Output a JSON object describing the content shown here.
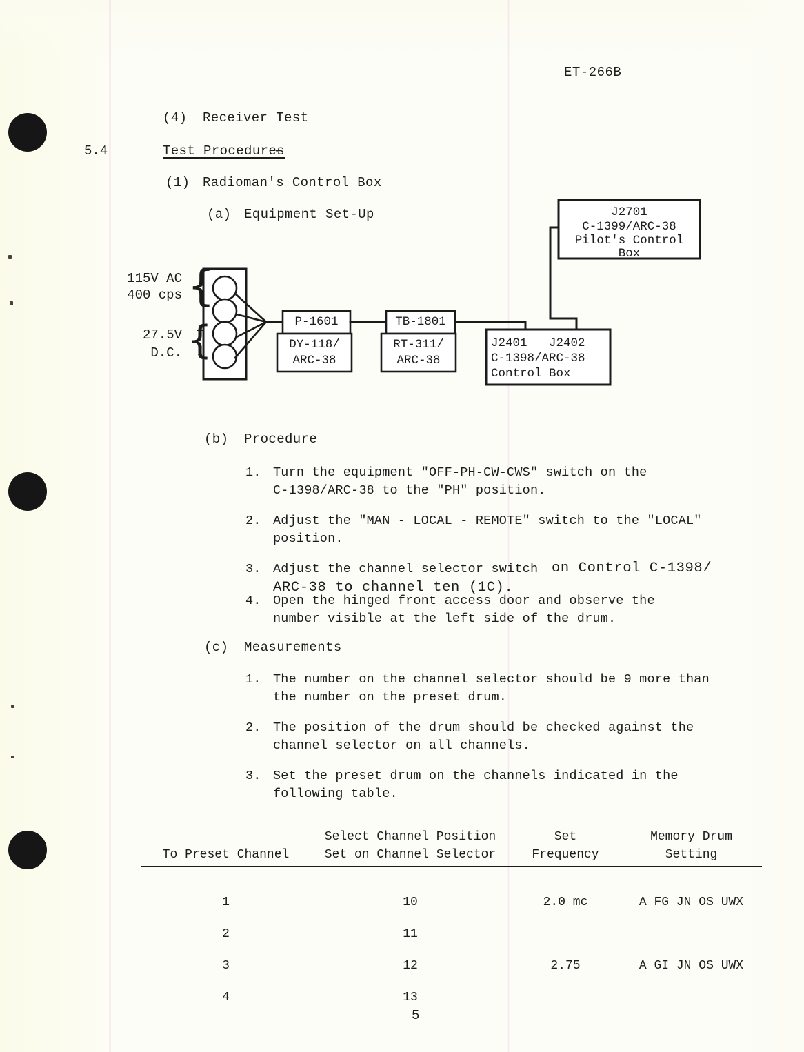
{
  "document": {
    "header_code": "ET-266B",
    "page_number": "5"
  },
  "outline": {
    "item_4_label": "(4)",
    "item_4_text": "Receiver Test",
    "section_number": "5.4",
    "section_title": "Test Procedures",
    "section_title_dash": "-",
    "item_1_label": "(1)",
    "item_1_text": "Radioman's Control Box",
    "item_a_label": "(a)",
    "item_a_text": "Equipment Set-Up",
    "item_b_label": "(b)",
    "item_b_text": "Procedure",
    "item_c_label": "(c)",
    "item_c_text": "Measurements"
  },
  "diagram": {
    "power_ac_line1": "115V AC",
    "power_ac_line2": "400 cps",
    "power_dc_line1": "27.5V",
    "power_dc_line2": "D.C.",
    "sign_plus": "+",
    "sign_minus": "-",
    "pilot_box": {
      "line1": "J2701",
      "line2": "C-1399/ARC-38",
      "line3": "Pilot's Control",
      "line4": "Box"
    },
    "p1601_tab": "P-1601",
    "dy118_line1": "DY-118/",
    "dy118_line2": "ARC-38",
    "tb1801_tab": "TB-1801",
    "rt311_line1": "RT-311/",
    "rt311_line2": "ARC-38",
    "control_box": {
      "line1": "J2401   J2402",
      "line2": "C-1398/ARC-38",
      "line3": "Control Box"
    }
  },
  "procedure": {
    "steps": [
      {
        "number": "1.",
        "line1": "Turn the equipment \"OFF-PH-CW-CWS\" switch on the",
        "line2": "C-1398/ARC-38 to the \"PH\" position."
      },
      {
        "number": "2.",
        "line1": "Adjust the \"MAN - LOCAL - REMOTE\" switch to the \"LOCAL\"",
        "line2": "position."
      },
      {
        "number": "3.",
        "line1_a": "Adjust the channel selector switch ",
        "line1_b": "on Control C-1398/",
        "line2": "ARC-38 to channel ten (1C)."
      },
      {
        "number": "4.",
        "line1": "Open the hinged front access door and observe the",
        "line2": "number visible at the left side of the drum."
      }
    ]
  },
  "measurements": {
    "steps": [
      {
        "number": "1.",
        "line1": "The number on the channel selector should be 9 more than",
        "line2": "the number on the preset drum."
      },
      {
        "number": "2.",
        "line1": "The position of the drum should be checked against the",
        "line2": "channel selector on all channels."
      },
      {
        "number": "3.",
        "line1": "Set the preset drum on the channels indicated in the",
        "line2": "following table."
      }
    ]
  },
  "table": {
    "headers": [
      "To Preset Channel",
      "Select Channel Position\nSet on Channel Selector",
      "Set\nFrequency",
      "Memory Drum\nSetting"
    ],
    "rows": [
      {
        "preset_channel": "1",
        "selector_position": "10",
        "set_frequency": "2.0 mc",
        "memory_drum": "A FG JN OS UWX"
      },
      {
        "preset_channel": "2",
        "selector_position": "11",
        "set_frequency": "",
        "memory_drum": ""
      },
      {
        "preset_channel": "3",
        "selector_position": "12",
        "set_frequency": "2.75",
        "memory_drum": "A GI JN OS UWX"
      },
      {
        "preset_channel": "4",
        "selector_position": "13",
        "set_frequency": "",
        "memory_drum": ""
      }
    ]
  }
}
